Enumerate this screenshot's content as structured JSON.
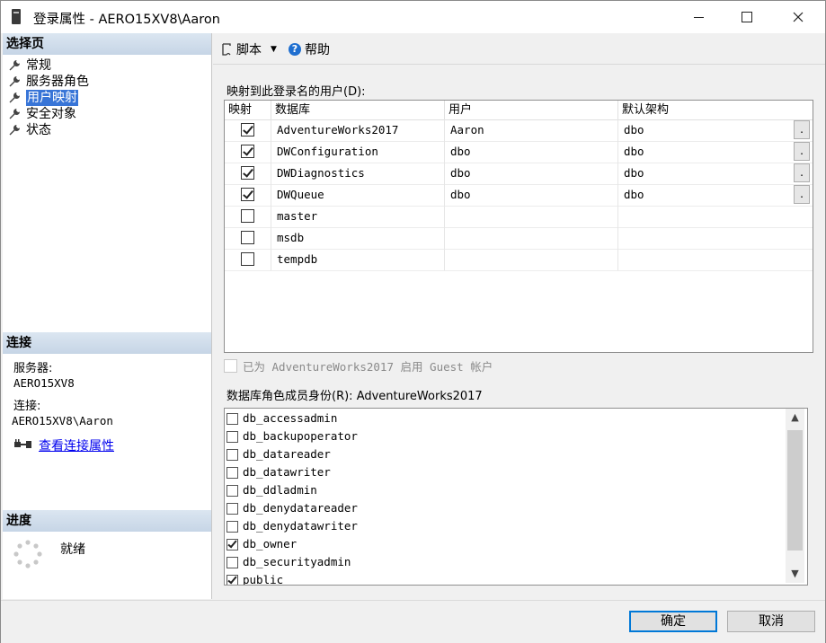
{
  "window": {
    "title": "登录属性 - AERO15XV8\\Aaron"
  },
  "icons": {
    "title": "database-server-icon",
    "minimize": "minimize-icon",
    "maximize": "maximize-icon",
    "close": "close-icon"
  },
  "left_pane": {
    "select_page_header": "选择页",
    "pages": [
      {
        "label": "常规",
        "selected": false
      },
      {
        "label": "服务器角色",
        "selected": false
      },
      {
        "label": "用户映射",
        "selected": true
      },
      {
        "label": "安全对象",
        "selected": false
      },
      {
        "label": "状态",
        "selected": false
      }
    ],
    "connection_header": "连接",
    "server_label": "服务器:",
    "server_value": "AERO15XV8",
    "connection_label": "连接:",
    "connection_value": "AERO15XV8\\Aaron",
    "view_connection_link": "查看连接属性",
    "progress_header": "进度",
    "status": "就绪"
  },
  "toolbar": {
    "script_label": "脚本",
    "help_label": "帮助"
  },
  "mapping": {
    "label": "映射到此登录名的用户(D):",
    "columns": [
      "映射",
      "数据库",
      "用户",
      "默认架构"
    ],
    "rows": [
      {
        "mapped": true,
        "database": "AdventureWorks2017",
        "user": "Aaron",
        "schema": "dbo",
        "has_button": true
      },
      {
        "mapped": true,
        "database": "DWConfiguration",
        "user": "dbo",
        "schema": "dbo",
        "has_button": true
      },
      {
        "mapped": true,
        "database": "DWDiagnostics",
        "user": "dbo",
        "schema": "dbo",
        "has_button": true
      },
      {
        "mapped": true,
        "database": "DWQueue",
        "user": "dbo",
        "schema": "dbo",
        "has_button": true
      },
      {
        "mapped": false,
        "database": "master",
        "user": "",
        "schema": "",
        "has_button": false
      },
      {
        "mapped": false,
        "database": "msdb",
        "user": "",
        "schema": "",
        "has_button": false
      },
      {
        "mapped": false,
        "database": "tempdb",
        "user": "",
        "schema": "",
        "has_button": false
      }
    ],
    "ellipsis": "."
  },
  "guest": {
    "label": "已为 AdventureWorks2017 启用 Guest 帐户",
    "checked": false
  },
  "roles": {
    "label": "数据库角色成员身份(R): AdventureWorks2017",
    "items": [
      {
        "name": "db_accessadmin",
        "checked": false
      },
      {
        "name": "db_backupoperator",
        "checked": false
      },
      {
        "name": "db_datareader",
        "checked": false
      },
      {
        "name": "db_datawriter",
        "checked": false
      },
      {
        "name": "db_ddladmin",
        "checked": false
      },
      {
        "name": "db_denydatareader",
        "checked": false
      },
      {
        "name": "db_denydatawriter",
        "checked": false
      },
      {
        "name": "db_owner",
        "checked": true
      },
      {
        "name": "db_securityadmin",
        "checked": false
      },
      {
        "name": "public",
        "checked": true
      }
    ]
  },
  "buttons": {
    "ok": "确定",
    "cancel": "取消"
  }
}
